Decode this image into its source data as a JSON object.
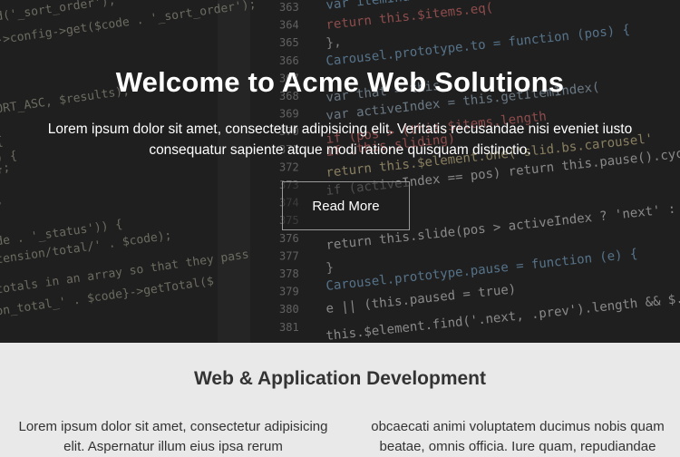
{
  "hero": {
    "title": "Welcome to Acme Web Solutions",
    "text": "Lorem ipsum dolor sit amet, consectetur adipisicing elit. Veritatis recusandae nisi eveniet iusto consequatur sapiente atque modi ratione quisquam distinctio.",
    "button_label": "Read More",
    "background": {
      "line_numbers": [
        "363",
        "364",
        "365",
        "366",
        "367",
        "368",
        "369",
        "370",
        "371",
        "372",
        "373",
        "374",
        "375",
        "376",
        "377",
        "378",
        "379",
        "380",
        "381"
      ],
      "code_left": [
        "d('_sort_order');",
        "->config->get($code . '_sort_order');",
        "ORT_ASC, $results);",
        "{",
        ") {",
        "};",
        ";",
        "de . '_status')) {",
        "tension/total/' . $code);",
        "totals in an array so that they pass",
        "on_total_' . $code}->getTotal($"
      ],
      "code_right": [
        "var itemIndex",
        "return this.$items.eq(",
        "},",
        "Carousel.prototype.to = function (pos) {",
        "var that = this",
        "var activeIndex = this.getItemIndex(",
        "if (pos > (this.$items.length",
        "if (this.sliding)",
        "return this.$element.one('slid.bs.carousel'",
        "if (activeIndex == pos) return this.pause().cycle()",
        "return this.slide(pos > activeIndex ? 'next' : 'prev', this.$items",
        "}",
        "Carousel.prototype.pause = function (e) {",
        "e || (this.paused = true)",
        "this.$element.find('.next, .prev').length && $.support.tra"
      ]
    }
  },
  "section": {
    "title": "Web & Application Development",
    "col_left": "Lorem ipsum dolor sit amet, consectetur adipisicing elit. Aspernatur illum eius ipsa rerum",
    "col_right": "obcaecati animi voluptatem ducimus nobis quam beatae, omnis officia. Iure quam, repudiandae"
  },
  "colors": {
    "hero_bg": "#2a2a2a",
    "section_bg": "#e9e9e9",
    "heading_text": "#333333",
    "hero_text": "#ffffff"
  }
}
